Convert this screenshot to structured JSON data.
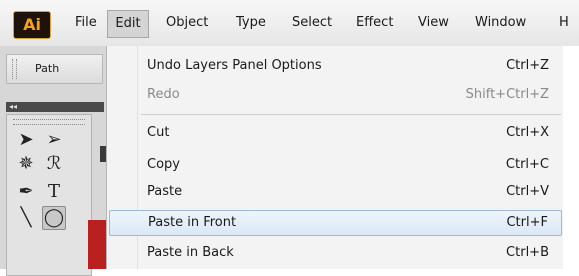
{
  "app": {
    "logo_text": "Ai"
  },
  "menubar": {
    "items": [
      {
        "label": "File"
      },
      {
        "label": "Edit"
      },
      {
        "label": "Object"
      },
      {
        "label": "Type"
      },
      {
        "label": "Select"
      },
      {
        "label": "Effect"
      },
      {
        "label": "View"
      },
      {
        "label": "Window"
      },
      {
        "label": "H"
      }
    ],
    "active": "Edit"
  },
  "panel": {
    "path_label": "Path",
    "collapse_glyph": "◂◂"
  },
  "tools": [
    {
      "icon": "selection-tool-icon",
      "glyph": "➤"
    },
    {
      "icon": "direct-selection-tool-icon",
      "glyph": "➢"
    },
    {
      "icon": "magic-wand-tool-icon",
      "glyph": "✵"
    },
    {
      "icon": "lasso-tool-icon",
      "glyph": "ℛ"
    },
    {
      "icon": "pen-tool-icon",
      "glyph": "✒"
    },
    {
      "icon": "type-tool-icon",
      "glyph": "T"
    },
    {
      "icon": "line-tool-icon",
      "glyph": "╲"
    },
    {
      "icon": "ellipse-tool-icon",
      "glyph": "◯"
    }
  ],
  "dropdown": {
    "items": [
      {
        "label": "Undo Layers Panel Options",
        "shortcut": "Ctrl+Z",
        "disabled": false
      },
      {
        "label": "Redo",
        "shortcut": "Shift+Ctrl+Z",
        "disabled": true
      },
      {
        "label": "Cut",
        "shortcut": "Ctrl+X",
        "disabled": false
      },
      {
        "label": "Copy",
        "shortcut": "Ctrl+C",
        "disabled": false
      },
      {
        "label": "Paste",
        "shortcut": "Ctrl+V",
        "disabled": false
      },
      {
        "label": "Paste in Front",
        "shortcut": "Ctrl+F",
        "disabled": false,
        "highlighted": true
      },
      {
        "label": "Paste in Back",
        "shortcut": "Ctrl+B",
        "disabled": false
      }
    ]
  },
  "colors": {
    "accent_highlight": "#dce8f6",
    "logo_orange": "#f4a018",
    "canvas_red": "#b92020"
  }
}
